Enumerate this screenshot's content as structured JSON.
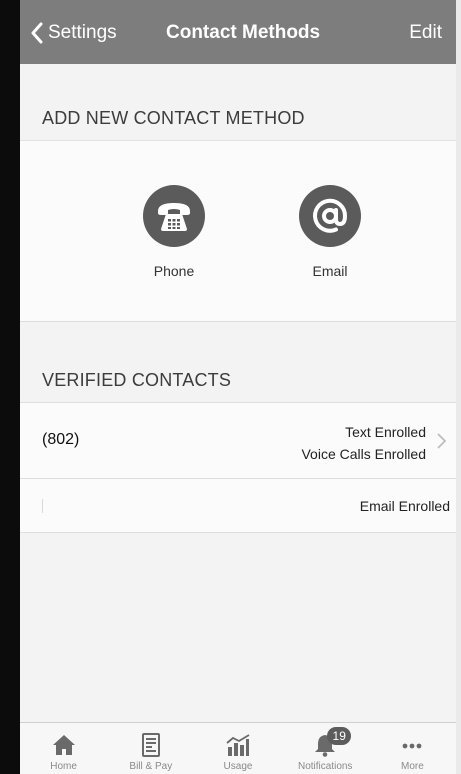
{
  "navbar": {
    "back_label": "Settings",
    "title": "Contact Methods",
    "edit_label": "Edit"
  },
  "add_section": {
    "header": "ADD NEW CONTACT METHOD",
    "methods": [
      {
        "label": "Phone",
        "icon": "telephone-icon"
      },
      {
        "label": "Email",
        "icon": "at-sign-icon"
      }
    ]
  },
  "verified_section": {
    "header": "VERIFIED CONTACTS",
    "contacts": [
      {
        "value": "(802)",
        "status": [
          "Text Enrolled",
          "Voice Calls Enrolled"
        ]
      },
      {
        "value": "",
        "status": [
          "Email Enrolled"
        ]
      }
    ]
  },
  "tabbar": {
    "tabs": [
      {
        "label": "Home",
        "icon": "home-icon"
      },
      {
        "label": "Bill & Pay",
        "icon": "bill-icon"
      },
      {
        "label": "Usage",
        "icon": "usage-chart-icon"
      },
      {
        "label": "Notifications",
        "icon": "bell-icon",
        "badge": "19"
      },
      {
        "label": "More",
        "icon": "more-dots-icon"
      }
    ]
  },
  "colors": {
    "navbar_bg": "#7d7d7d",
    "icon_circle": "#5b5b5b",
    "tab_icon": "#6a6a6a"
  }
}
